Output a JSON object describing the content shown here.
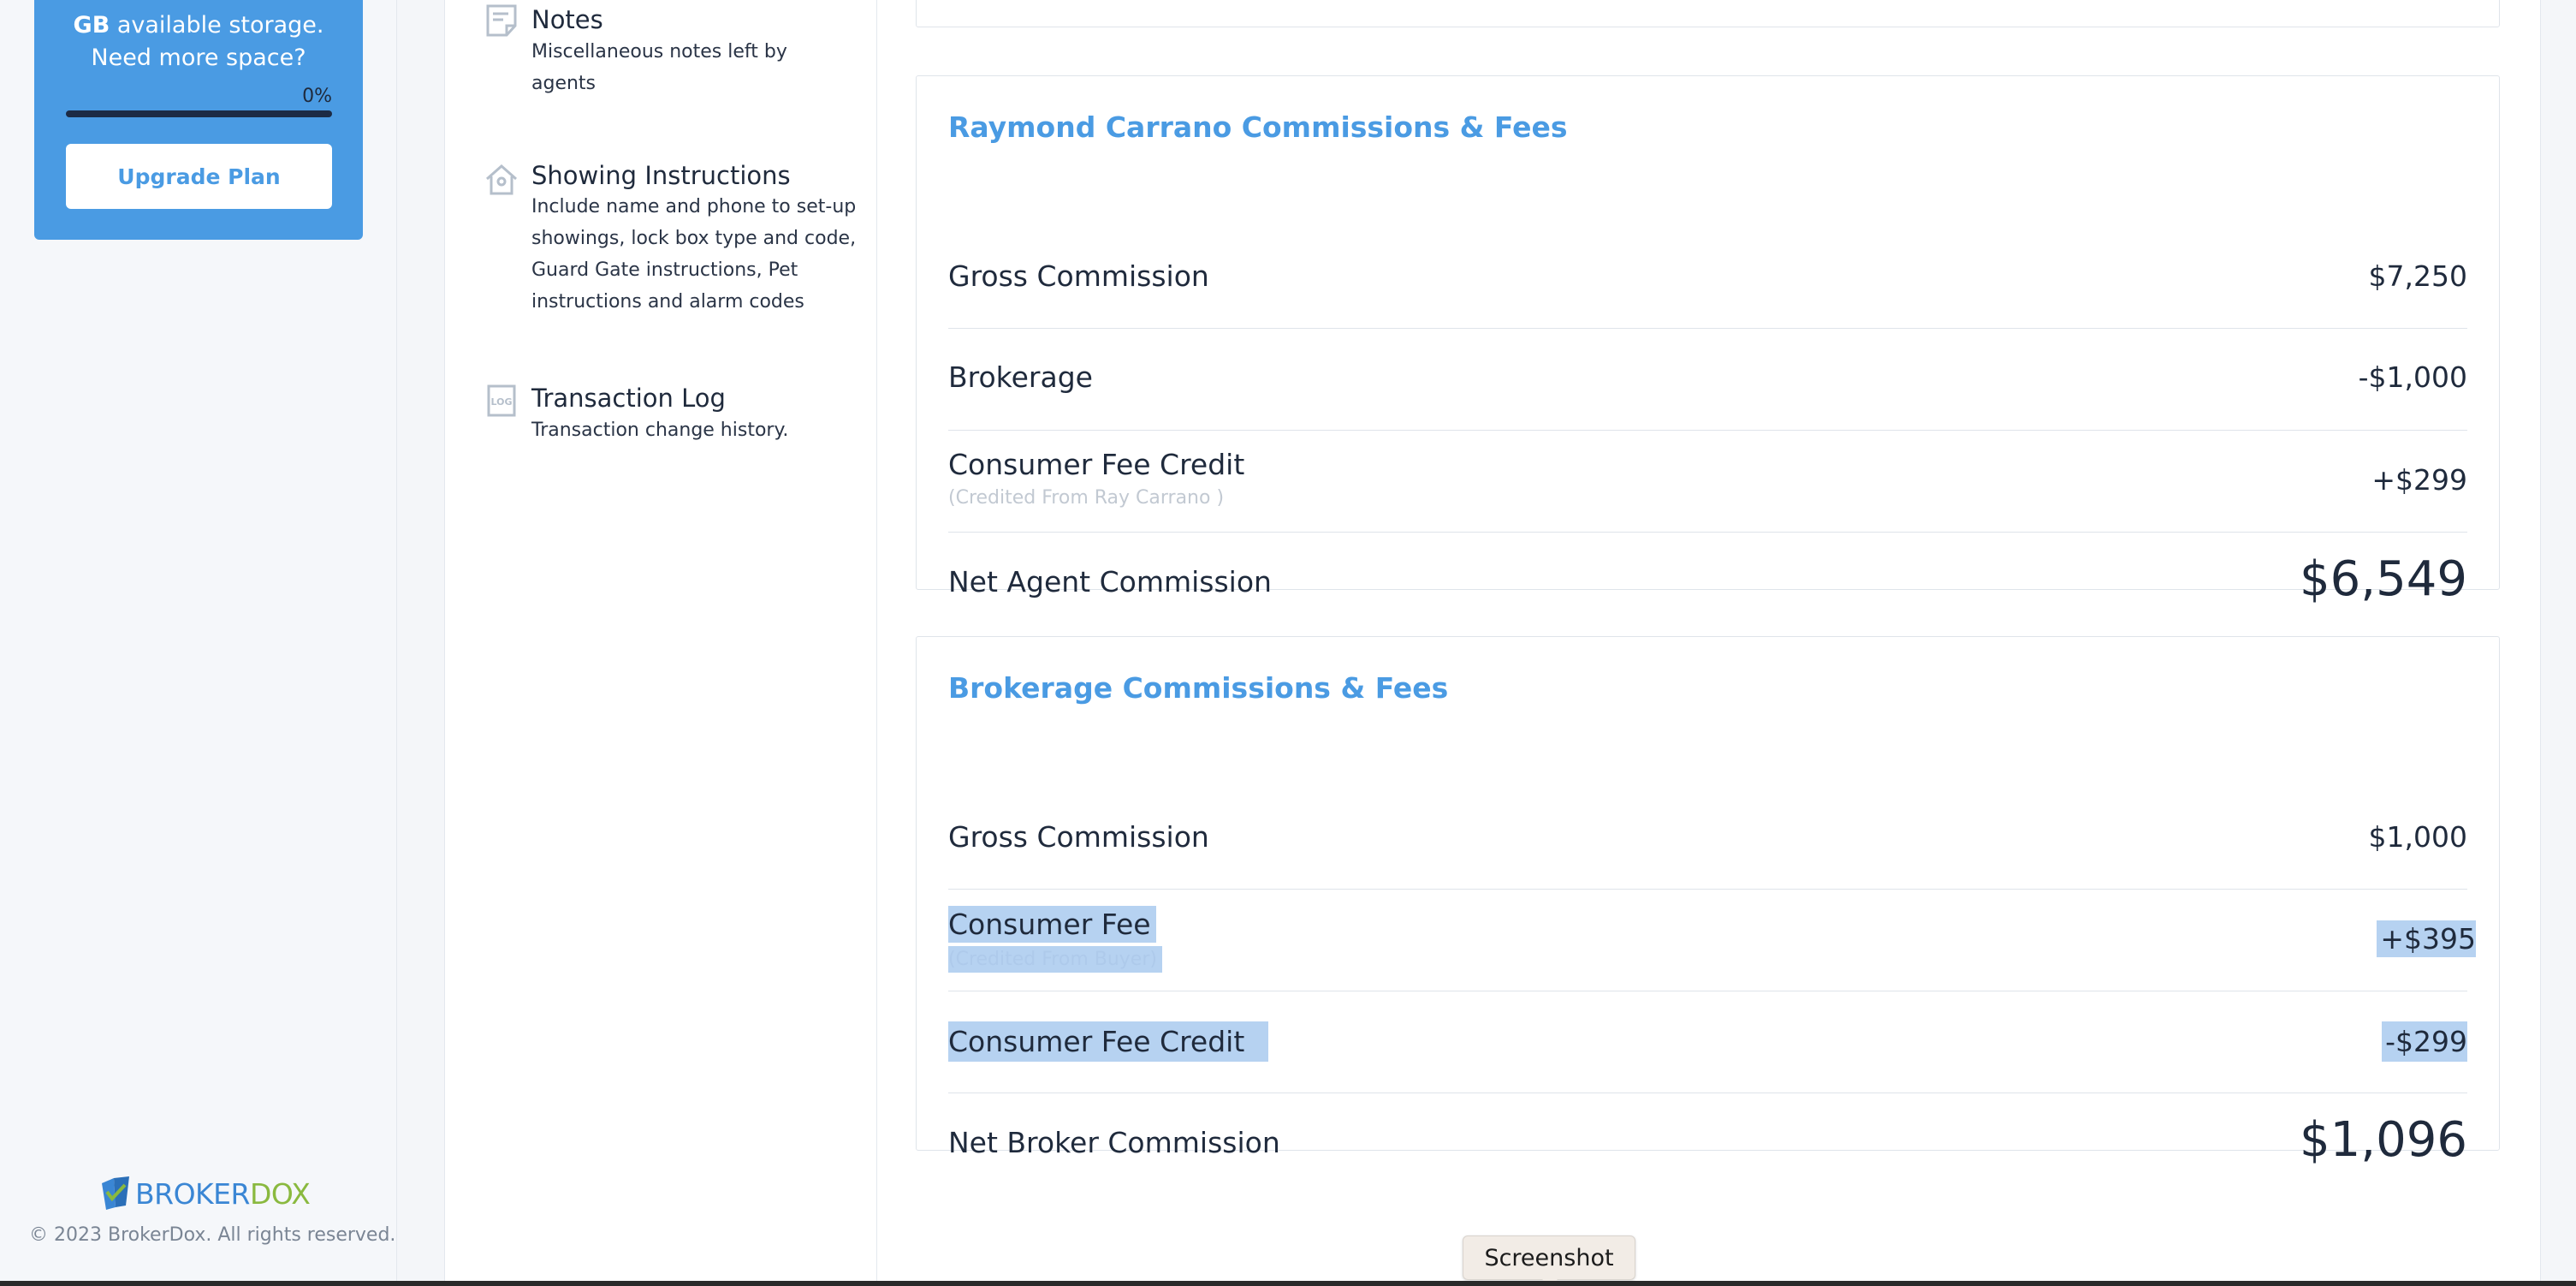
{
  "sidebar": {
    "storage": {
      "unit": "GB",
      "line1_rest": " available storage.",
      "line2": "Need more space?",
      "percent_label": "0%",
      "percent_value": 0
    },
    "upgrade_label": "Upgrade Plan",
    "logo": {
      "part1": "BROKER",
      "part2": "DOX"
    },
    "copyright": "© 2023 BrokerDox. All rights reserved."
  },
  "sections": [
    {
      "title": "Notes",
      "description": "Miscellaneous notes left by agents",
      "icon": "note-icon"
    },
    {
      "title": "Showing Instructions",
      "description": "Include name and phone to set-up showings, lock box type and code, Guard Gate instructions, Pet instructions and alarm codes",
      "icon": "house-icon"
    },
    {
      "title": "Transaction Log",
      "description": "Transaction change history.",
      "icon": "log-icon"
    }
  ],
  "agent_card": {
    "title": "Raymond Carrano Commissions & Fees",
    "rows": [
      {
        "label": "Gross Commission",
        "amount": "$7,250"
      },
      {
        "label": "Brokerage",
        "amount": "-$1,000"
      },
      {
        "label": "Consumer Fee Credit",
        "sub": "(Credited From Ray Carrano )",
        "amount": "+$299"
      },
      {
        "label": "Net Agent Commission",
        "amount": "$6,549"
      }
    ]
  },
  "broker_card": {
    "title": "Brokerage Commissions & Fees",
    "rows": [
      {
        "label": "Gross Commission",
        "amount": "$1,000"
      },
      {
        "label": "Consumer Fee",
        "sub": "(Credited From Buyer)",
        "amount": "+$395"
      },
      {
        "label": "Consumer Fee Credit",
        "amount": "-$299"
      },
      {
        "label": "Net Broker Commission",
        "amount": "$1,096"
      }
    ]
  },
  "tooltip": "Screenshot",
  "colors": {
    "accent": "#4a9be3",
    "logo_blue": "#3a86d4",
    "logo_green": "#8ab93f",
    "selection": "#b6d2f1"
  }
}
